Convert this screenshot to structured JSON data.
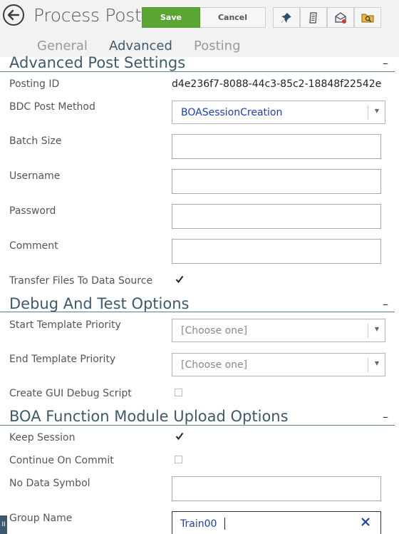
{
  "header": {
    "title": "Process Post",
    "save_label": "Save",
    "cancel_label": "Cancel",
    "toolbar_icons": [
      "pin-icon",
      "document-icon",
      "email-alert-icon",
      "folder-search-icon"
    ],
    "tabs": [
      {
        "label": "General",
        "active": false
      },
      {
        "label": "Advanced",
        "active": true
      },
      {
        "label": "Posting",
        "active": false
      }
    ]
  },
  "advanced": {
    "title": "Advanced Post Settings",
    "collapse": "–",
    "posting_id_label": "Posting ID",
    "posting_id_value": "d4e236f7-8088-44c3-85c2-18848f22542e",
    "bdc_label": "BDC Post Method",
    "bdc_value": "BOASessionCreation",
    "batch_label": "Batch Size",
    "batch_value": "",
    "username_label": "Username",
    "username_value": "",
    "password_label": "Password",
    "password_value": "",
    "comment_label": "Comment",
    "comment_value": "",
    "transfer_label": "Transfer Files To Data Source",
    "transfer_checked": true
  },
  "debug": {
    "title": "Debug And Test Options",
    "collapse": "–",
    "start_label": "Start Template Priority",
    "start_value": "[Choose one]",
    "end_label": "End Template Priority",
    "end_value": "[Choose one]",
    "gui_label": "Create GUI Debug Script",
    "gui_checked": false
  },
  "boa": {
    "title": "BOA Function Module Upload Options",
    "collapse": "–",
    "keep_label": "Keep Session",
    "keep_checked": true,
    "continue_label": "Continue On Commit",
    "continue_checked": false,
    "nodata_label": "No Data Symbol",
    "nodata_value": "",
    "group_label": "Group Name",
    "group_value": "Train00"
  },
  "colors": {
    "accent": "#3d5a6c",
    "save_green": "#5ba535",
    "link_blue": "#1a3fb5"
  }
}
